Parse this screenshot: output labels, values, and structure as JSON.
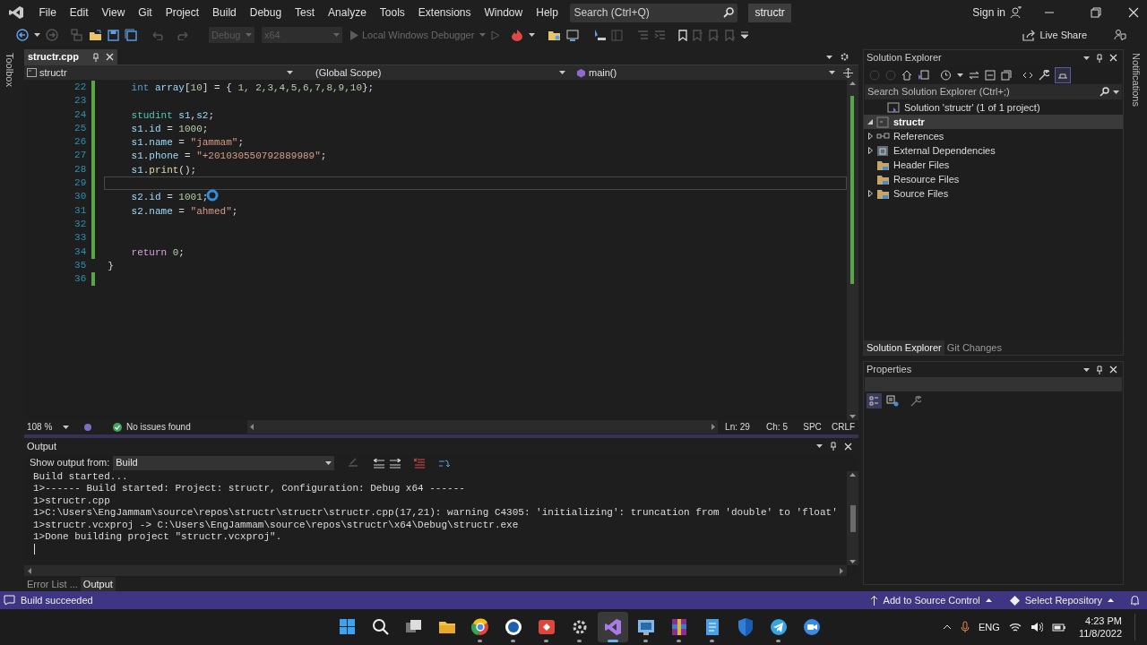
{
  "title_bar": {
    "menu": [
      "File",
      "Edit",
      "View",
      "Git",
      "Project",
      "Build",
      "Debug",
      "Test",
      "Analyze",
      "Tools",
      "Extensions",
      "Window",
      "Help"
    ],
    "search": {
      "placeholder": "Search (Ctrl+Q)"
    },
    "solution_name": "structr",
    "sign_in": "Sign in"
  },
  "toolbar": {
    "configuration": {
      "value": "Debug",
      "disabled": true
    },
    "platform": {
      "value": "x64",
      "disabled": true
    },
    "debugger": {
      "label": "Local Windows Debugger",
      "disabled": true
    },
    "live_share": "Live Share"
  },
  "toolbox_label": "Toolbox",
  "editor": {
    "tabs": [
      {
        "label": "structr.cpp",
        "selected": true
      }
    ],
    "nav": {
      "project": "structr",
      "scope": "(Global Scope)",
      "member": "main()"
    },
    "lines": [
      {
        "number": "22",
        "changed": true,
        "current": false,
        "tokens": [
          {
            "kind": "keyword",
            "text": "    int"
          },
          {
            "kind": "variable",
            "text": " array"
          },
          {
            "kind": "plain",
            "text": "["
          },
          {
            "kind": "number",
            "text": "10"
          },
          {
            "kind": "plain",
            "text": "] = { "
          },
          {
            "kind": "number",
            "text": "1, 2,3,4,5,6,7,8,9,10"
          },
          {
            "kind": "plain",
            "text": "};"
          }
        ]
      },
      {
        "number": "23",
        "changed": true,
        "current": false
      },
      {
        "number": "24",
        "changed": true,
        "current": false,
        "tokens": [
          {
            "kind": "type",
            "text": "    studint"
          },
          {
            "kind": "variable",
            "text": " s1"
          },
          {
            "kind": "plain",
            "text": ","
          },
          {
            "kind": "variable",
            "text": "s2"
          },
          {
            "kind": "plain",
            "text": ";"
          }
        ]
      },
      {
        "number": "25",
        "changed": true,
        "current": false,
        "tokens": [
          {
            "kind": "variable",
            "text": "    s1"
          },
          {
            "kind": "plain",
            "text": "."
          },
          {
            "kind": "variable",
            "text": "id"
          },
          {
            "kind": "plain",
            "text": " = "
          },
          {
            "kind": "number",
            "text": "1000"
          },
          {
            "kind": "plain",
            "text": ";"
          }
        ]
      },
      {
        "number": "26",
        "changed": true,
        "current": false,
        "tokens": [
          {
            "kind": "variable",
            "text": "    s1"
          },
          {
            "kind": "plain",
            "text": "."
          },
          {
            "kind": "variable",
            "text": "name"
          },
          {
            "kind": "plain",
            "text": " = "
          },
          {
            "kind": "string",
            "text": "\"jammam\""
          },
          {
            "kind": "plain",
            "text": ";"
          }
        ]
      },
      {
        "number": "27",
        "changed": true,
        "current": false,
        "tokens": [
          {
            "kind": "variable",
            "text": "    s1"
          },
          {
            "kind": "plain",
            "text": "."
          },
          {
            "kind": "variable",
            "text": "phone"
          },
          {
            "kind": "plain",
            "text": " = "
          },
          {
            "kind": "string",
            "text": "\"+201030550792889989\""
          },
          {
            "kind": "plain",
            "text": ";"
          }
        ]
      },
      {
        "number": "28",
        "changed": true,
        "current": false,
        "tokens": [
          {
            "kind": "variable",
            "text": "    s1"
          },
          {
            "kind": "plain",
            "text": "."
          },
          {
            "kind": "function",
            "text": "print"
          },
          {
            "kind": "plain",
            "text": "();"
          }
        ]
      },
      {
        "number": "29",
        "changed": true,
        "current": true
      },
      {
        "number": "30",
        "changed": true,
        "current": false,
        "tokens": [
          {
            "kind": "variable",
            "text": "    s2"
          },
          {
            "kind": "plain",
            "text": "."
          },
          {
            "kind": "variable",
            "text": "id"
          },
          {
            "kind": "plain",
            "text": " = "
          },
          {
            "kind": "number",
            "text": "1001"
          },
          {
            "kind": "plain",
            "text": ";"
          }
        ]
      },
      {
        "number": "31",
        "changed": true,
        "current": false,
        "tokens": [
          {
            "kind": "variable",
            "text": "    s2"
          },
          {
            "kind": "plain",
            "text": "."
          },
          {
            "kind": "variable",
            "text": "name"
          },
          {
            "kind": "plain",
            "text": " = "
          },
          {
            "kind": "string",
            "text": "\"ahmed\""
          },
          {
            "kind": "plain",
            "text": ";"
          }
        ]
      },
      {
        "number": "32",
        "changed": true,
        "current": false
      },
      {
        "number": "33",
        "changed": true,
        "current": false
      },
      {
        "number": "34",
        "changed": true,
        "current": false,
        "tokens": [
          {
            "kind": "control",
            "text": "    return"
          },
          {
            "kind": "number",
            "text": " 0"
          },
          {
            "kind": "plain",
            "text": ";"
          }
        ]
      },
      {
        "number": "35",
        "changed": false,
        "current": false,
        "tokens": [
          {
            "kind": "plain",
            "text": "}"
          }
        ]
      },
      {
        "number": "36",
        "changed": true,
        "current": false
      }
    ],
    "status": {
      "zoom": "108 %",
      "issues": "No issues found",
      "line": "Ln: 29",
      "column": "Ch: 5",
      "whitespace": "SPC",
      "line_ending": "CRLF"
    }
  },
  "output": {
    "title": "Output",
    "show_from_label": "Show output from:",
    "source": "Build",
    "lines": [
      "Build started...",
      "1>------ Build started: Project: structr, Configuration: Debug x64 ------",
      "1>structr.cpp",
      "1>C:\\Users\\EngJammam\\source\\repos\\structr\\structr\\structr.cpp(17,21): warning C4305: 'initializing': truncation from 'double' to 'float'",
      "1>structr.vcxproj -> C:\\Users\\EngJammam\\source\\repos\\structr\\x64\\Debug\\structr.exe",
      "1>Done building project \"structr.vcxproj\"."
    ],
    "tabs": [
      {
        "label": "Error List ...",
        "selected": false
      },
      {
        "label": "Output",
        "selected": true
      }
    ]
  },
  "solution_explorer": {
    "title": "Solution Explorer",
    "search": {
      "placeholder": "Search Solution Explorer (Ctrl+;)"
    },
    "tree": [
      {
        "label": "Solution 'structr' (1 of 1 project)",
        "kind": "solution",
        "expandable": false,
        "selected": false,
        "children": [
          {
            "label": "structr",
            "kind": "project",
            "expandable": true,
            "expanded": true,
            "selected": true,
            "children": [
              {
                "label": "References",
                "kind": "references",
                "expandable": true,
                "expanded": false,
                "selected": false
              },
              {
                "label": "External Dependencies",
                "kind": "dependencies",
                "expandable": true,
                "expanded": false,
                "selected": false
              },
              {
                "label": "Header Files",
                "kind": "folder",
                "expandable": false,
                "selected": false
              },
              {
                "label": "Resource Files",
                "kind": "folder",
                "expandable": false,
                "selected": false
              },
              {
                "label": "Source Files",
                "kind": "folder",
                "expandable": true,
                "expanded": false,
                "selected": false
              }
            ]
          }
        ]
      }
    ],
    "tabs": [
      {
        "label": "Solution Explorer",
        "selected": true
      },
      {
        "label": "Git Changes",
        "selected": false
      }
    ]
  },
  "properties": {
    "title": "Properties"
  },
  "notifications_label": "Notifications",
  "status_bar": {
    "message": "Build succeeded",
    "source_control": "Add to Source Control",
    "repository": "Select Repository"
  },
  "taskbar": {
    "apps": [
      {
        "running": false,
        "selected": false
      },
      {
        "running": false,
        "selected": false
      },
      {
        "running": false,
        "selected": false
      },
      {
        "running": false,
        "selected": false
      },
      {
        "running": true,
        "selected": false
      },
      {
        "running": true,
        "selected": false
      },
      {
        "running": true,
        "selected": false
      },
      {
        "running": true,
        "selected": false
      },
      {
        "running": true,
        "selected": true
      },
      {
        "running": true,
        "selected": false
      },
      {
        "running": true,
        "selected": false
      },
      {
        "running": true,
        "selected": false
      },
      {
        "running": false,
        "selected": false
      },
      {
        "running": true,
        "selected": false
      },
      {
        "running": false,
        "selected": false
      }
    ],
    "language": "ENG",
    "time": "4:23 PM",
    "date": "11/8/2022"
  }
}
